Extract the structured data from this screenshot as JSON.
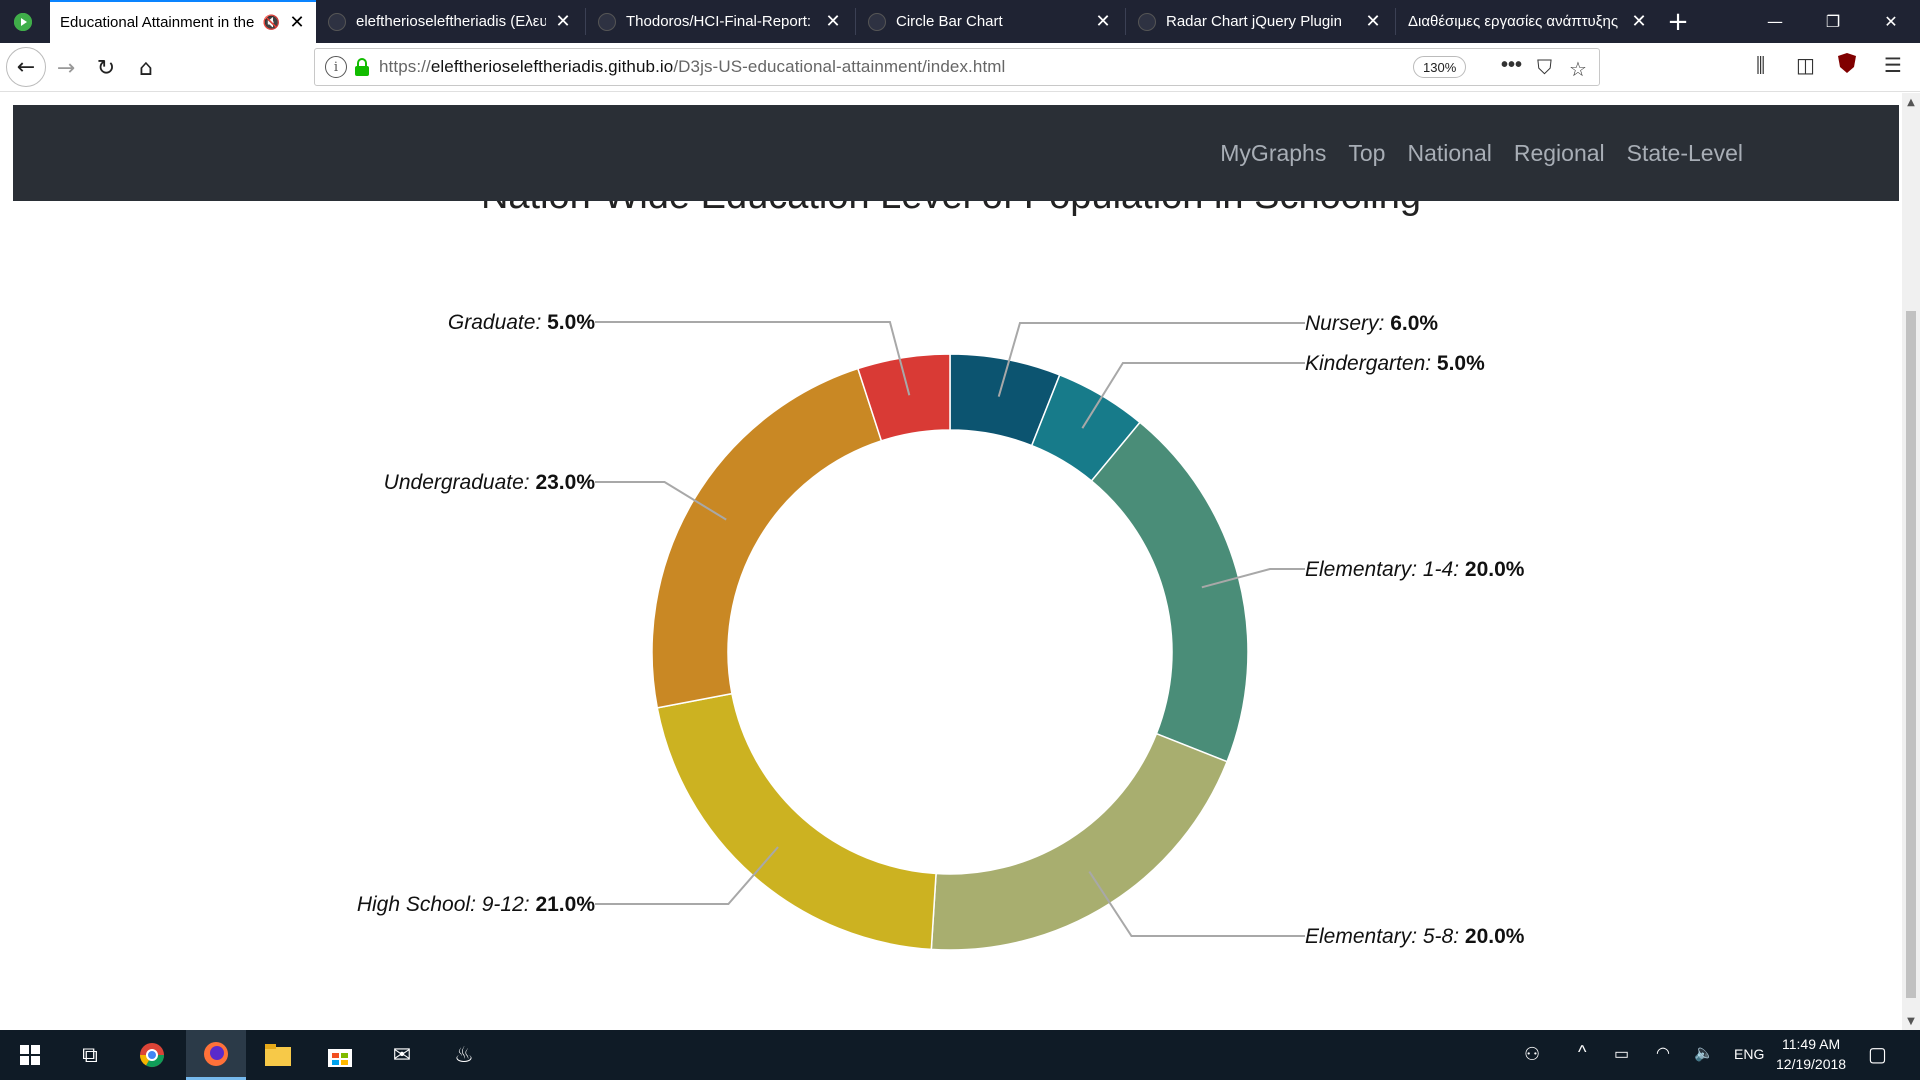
{
  "browser": {
    "tabs": [
      {
        "title": "Educational Attainment in the",
        "active": true,
        "icon": "play-icon"
      },
      {
        "title": "eleftherioseleftheriadis (Ελευ",
        "active": false,
        "icon": "github-icon"
      },
      {
        "title": "Thodoros/HCI-Final-Report: I",
        "active": false,
        "icon": "github-icon"
      },
      {
        "title": "Circle Bar Chart",
        "active": false,
        "icon": "page-icon"
      },
      {
        "title": "Radar Chart jQuery Plugin",
        "active": false,
        "icon": "page-icon"
      },
      {
        "title": "Διαθέσιμες εργασίες ανάπτυξης",
        "active": false,
        "icon": "page-icon"
      }
    ],
    "url_prefix": "https://",
    "url_domain": "eleftherioseleftheriadis.github.io",
    "url_path": "/D3js-US-educational-attainment/index.html",
    "zoom": "130%"
  },
  "site": {
    "nav": [
      "MyGraphs",
      "Top",
      "National",
      "Regional",
      "State-Level"
    ]
  },
  "chart_title": "Nation-Wide Education Level of Population in Schooling",
  "chart_data": {
    "type": "pie",
    "subtype": "donut",
    "slices": [
      {
        "label": "Nursery:",
        "value": "6.0%",
        "pct": 6.0,
        "color": "#0c5470"
      },
      {
        "label": "Kindergarten:",
        "value": "5.0%",
        "pct": 5.0,
        "color": "#177b8a"
      },
      {
        "label": "Elementary: 1-4:",
        "value": "20.0%",
        "pct": 20.0,
        "color": "#4a8d78"
      },
      {
        "label": "Elementary: 5-8:",
        "value": "20.0%",
        "pct": 20.0,
        "color": "#a8ae6f"
      },
      {
        "label": "High School: 9-12:",
        "value": "21.0%",
        "pct": 21.0,
        "color": "#ccb221"
      },
      {
        "label": "Undergraduate:",
        "value": "23.0%",
        "pct": 23.0,
        "color": "#c98824"
      },
      {
        "label": "Graduate:",
        "value": "5.0%",
        "pct": 5.0,
        "color": "#d93a35"
      }
    ]
  },
  "taskbar": {
    "language": "ENG",
    "time": "11:49 AM",
    "date": "12/19/2018"
  }
}
